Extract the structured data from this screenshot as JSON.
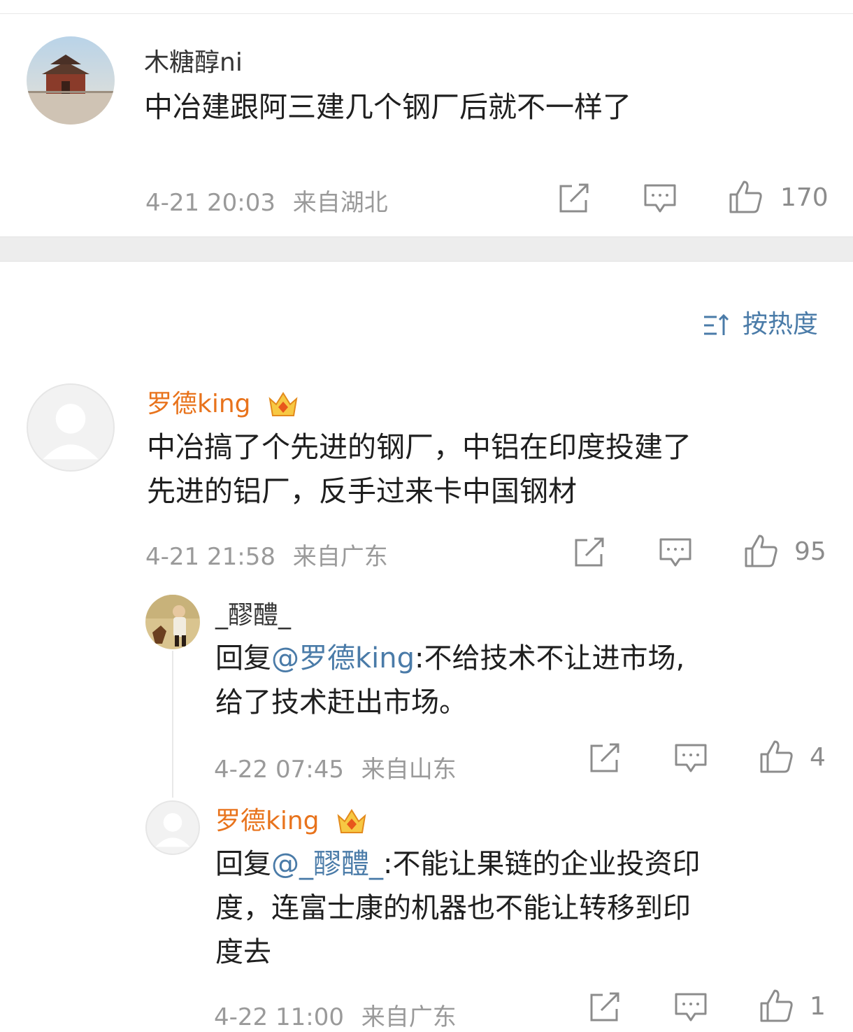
{
  "comments": [
    {
      "user": "木糖醇ni",
      "text": "中冶建跟阿三建几个钢厂后就不一样了",
      "date": "4-21 20:03",
      "location": "来自湖北",
      "likes": "170",
      "avatar_icon": "city-gate-photo"
    }
  ],
  "sort": {
    "label": "按热度",
    "icon": "sort-icon"
  },
  "hot_comment": {
    "user": "罗德king",
    "badge_icon": "crown-icon",
    "text_line1": "中冶搞了个先进的钢厂，中铝在印度投建了",
    "text_line2": "先进的铝厂，反手过来卡中国钢材",
    "date": "4-21 21:58",
    "location": "来自广东",
    "likes": "95",
    "replies": [
      {
        "user": "_醪醴_",
        "prefix": "回复",
        "mention": "@罗德king",
        "text_line1_rest": ":不给技术不让进市场,",
        "text_line2": "给了技术赶出市场。",
        "date": "4-22 07:45",
        "location": "来自山东",
        "likes": "4"
      },
      {
        "user": "罗德king",
        "prefix": "回复",
        "mention": "@_醪醴_",
        "text_line1_rest": ":不能让果链的企业投资印",
        "text_line2": "度，连富士康的机器也不能让转移到印",
        "text_line3": "度去",
        "date": "4-22 11:00",
        "location": "来自广东",
        "likes": "1"
      }
    ]
  },
  "colors": {
    "vip_name": "#e8731c",
    "link": "#4a7ba8",
    "meta": "#9a9a9a",
    "divider": "#ededed"
  }
}
